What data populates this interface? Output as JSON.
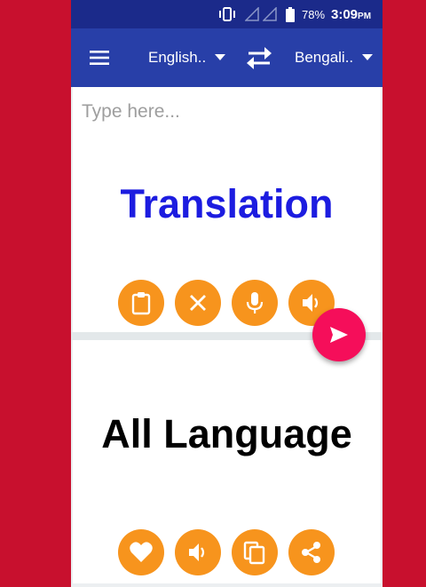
{
  "status_bar": {
    "battery_percent": "78%",
    "time": "3:09",
    "ampm": "PM",
    "icons": [
      "vibrate-icon",
      "signal-icon",
      "signal-icon",
      "battery-icon"
    ]
  },
  "toolbar": {
    "source_language": "English..",
    "target_language": "Bengali..",
    "icons": [
      "menu-icon",
      "swap-icon",
      "dropdown-caret-icon"
    ]
  },
  "input_panel": {
    "placeholder": "Type here...",
    "banner": "Translation",
    "buttons": [
      "paste-icon",
      "clear-icon",
      "mic-icon",
      "speaker-icon"
    ]
  },
  "output_panel": {
    "banner": "All Language",
    "buttons": [
      "favorite-icon",
      "speaker-icon",
      "copy-icon",
      "share-icon"
    ]
  },
  "fab": {
    "icon": "send-icon"
  },
  "colors": {
    "background": "#c8102e",
    "status_bar": "#1b2a8a",
    "toolbar": "#283fa8",
    "action_button": "#f7941d",
    "fab": "#f50e5a",
    "banner_blue": "#1c1ce0"
  }
}
